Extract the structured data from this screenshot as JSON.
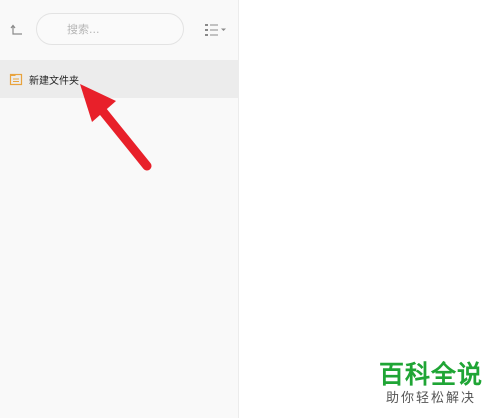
{
  "toolbar": {
    "up_icon": "folder-up-icon",
    "search_placeholder": "搜索...",
    "view_icon": "list-view-icon"
  },
  "folder": {
    "label": "新建文件夹",
    "icon": "folder-icon",
    "icon_color": "#e8a33d"
  },
  "annotation": {
    "arrow_color": "#e8202a"
  },
  "watermark": {
    "logo": "百科全说",
    "slogan": "助你轻松解决",
    "logo_color": "#1fa535"
  }
}
